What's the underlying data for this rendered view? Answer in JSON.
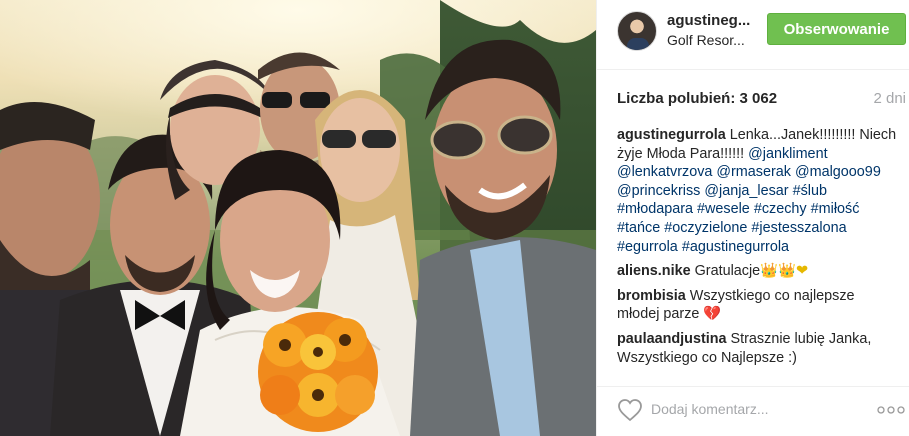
{
  "header": {
    "username": "agustineg...",
    "location": "Golf Resor...",
    "follow_label": "Obserwowanie"
  },
  "meta": {
    "likes": "Liczba polubień: 3 062",
    "time": "2 dni"
  },
  "caption": {
    "author": "agustinegurrola",
    "text": " Lenka...Janek!!!!!!!!! Niech żyje Młoda Para!!!!!! ",
    "tags": [
      "@jankliment",
      "@lenkatvrzova",
      "@rmaserak",
      "@malgooo99",
      "@princekriss",
      "@janja_lesar",
      "#ślub",
      "#młodapara",
      "#wesele",
      "#czechy",
      "#miłość",
      "#tańce",
      "#oczyzielone",
      "#jestesszalona",
      "#egurrola",
      "#agustinegurrola"
    ]
  },
  "comments": [
    {
      "author": "aliens.nike",
      "text": " Gratulacje",
      "emoji": "👑👑❤"
    },
    {
      "author": "brombisia",
      "text": " Wszystkiego co najlepsze młodej parze ",
      "emoji": "💔"
    },
    {
      "author": "paulaandjustina",
      "text": " Strasznie lubię Janka, Wszystkiego co Najlepsze :)",
      "emoji": ""
    }
  ],
  "footer": {
    "comment_placeholder": "Dodaj komentarz...",
    "like_icon": "heart-outline-icon",
    "more_icon": "more-dots-icon"
  },
  "colors": {
    "follow_button": "#70c050",
    "hashtag": "#003569",
    "muted": "#a5a7aa"
  }
}
